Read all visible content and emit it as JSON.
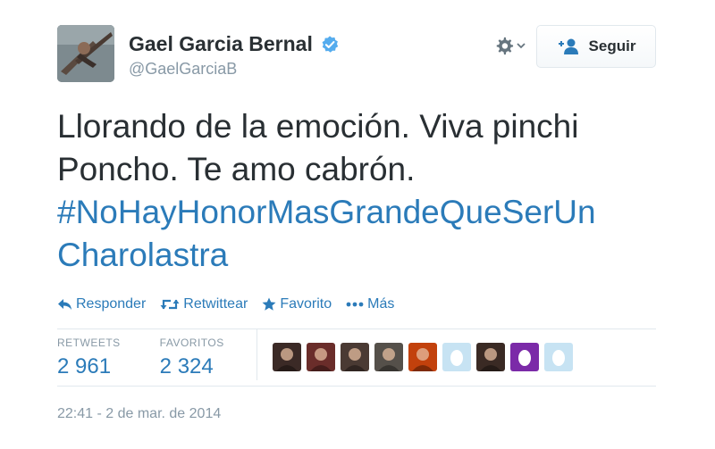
{
  "user": {
    "name": "Gael Garcia Bernal",
    "handle": "@GaelGarciaB"
  },
  "follow": {
    "label": "Seguir"
  },
  "tweet": {
    "text": "Llorando de la emoción. Viva pinchi Poncho. Te amo cabrón.",
    "hashtag": "#NoHayHonorMasGrandeQueSerUn Charolastra"
  },
  "actions": [
    {
      "label": "Responder",
      "icon": "reply-icon"
    },
    {
      "label": "Retwittear",
      "icon": "retweet-icon"
    },
    {
      "label": "Favorito",
      "icon": "star-icon"
    },
    {
      "label": "Más",
      "icon": "more-icon"
    }
  ],
  "stats": {
    "retweets_label": "RETWEETS",
    "retweets_value": "2 961",
    "favorites_label": "FAVORITOS",
    "favorites_value": "2 324"
  },
  "favoriters": [
    "#3b2a26",
    "#6a2d2a",
    "#4a3a33",
    "#55504a",
    "#c2410c",
    "#c7e3f3",
    "#3a2a24",
    "#7b2aa8",
    "#c7e3f3"
  ],
  "timestamp": "22:41 - 2 de mar. de 2014",
  "colors": {
    "link": "#2b7bb9",
    "muted": "#8899a6",
    "verified": "#55acee"
  }
}
